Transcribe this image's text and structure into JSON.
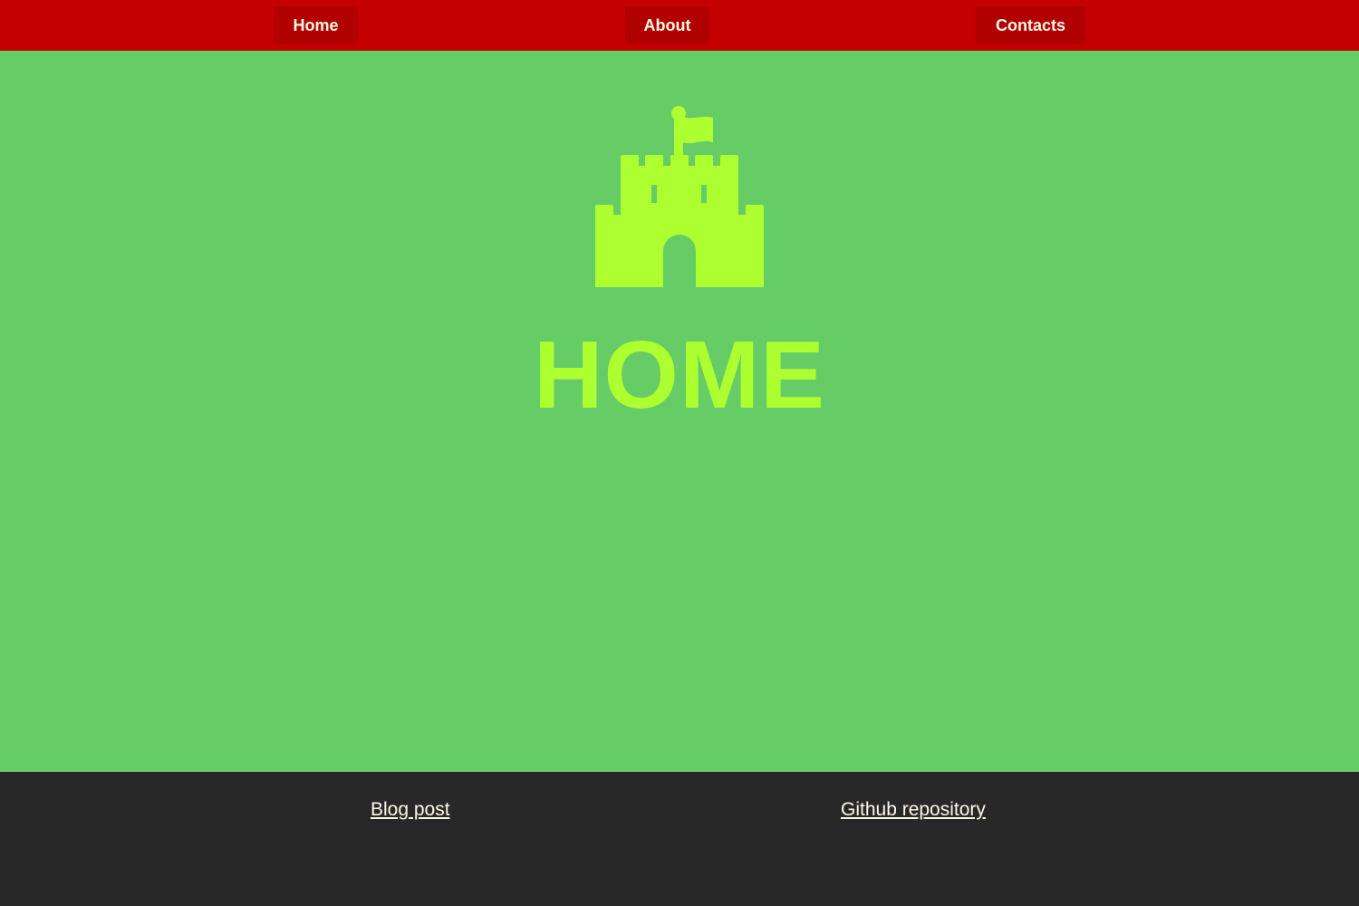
{
  "nav": {
    "items": [
      {
        "label": "Home"
      },
      {
        "label": "About"
      },
      {
        "label": "Contacts"
      }
    ],
    "background_color": "#c40000",
    "button_color": "#b00000"
  },
  "main": {
    "icon": "castle-icon",
    "heading": "HOME",
    "accent_color": "#adff2f",
    "background_color": "#66cc66"
  },
  "footer": {
    "links": [
      {
        "label": "Blog post"
      },
      {
        "label": "Github repository"
      }
    ],
    "background_color": "#282828"
  }
}
